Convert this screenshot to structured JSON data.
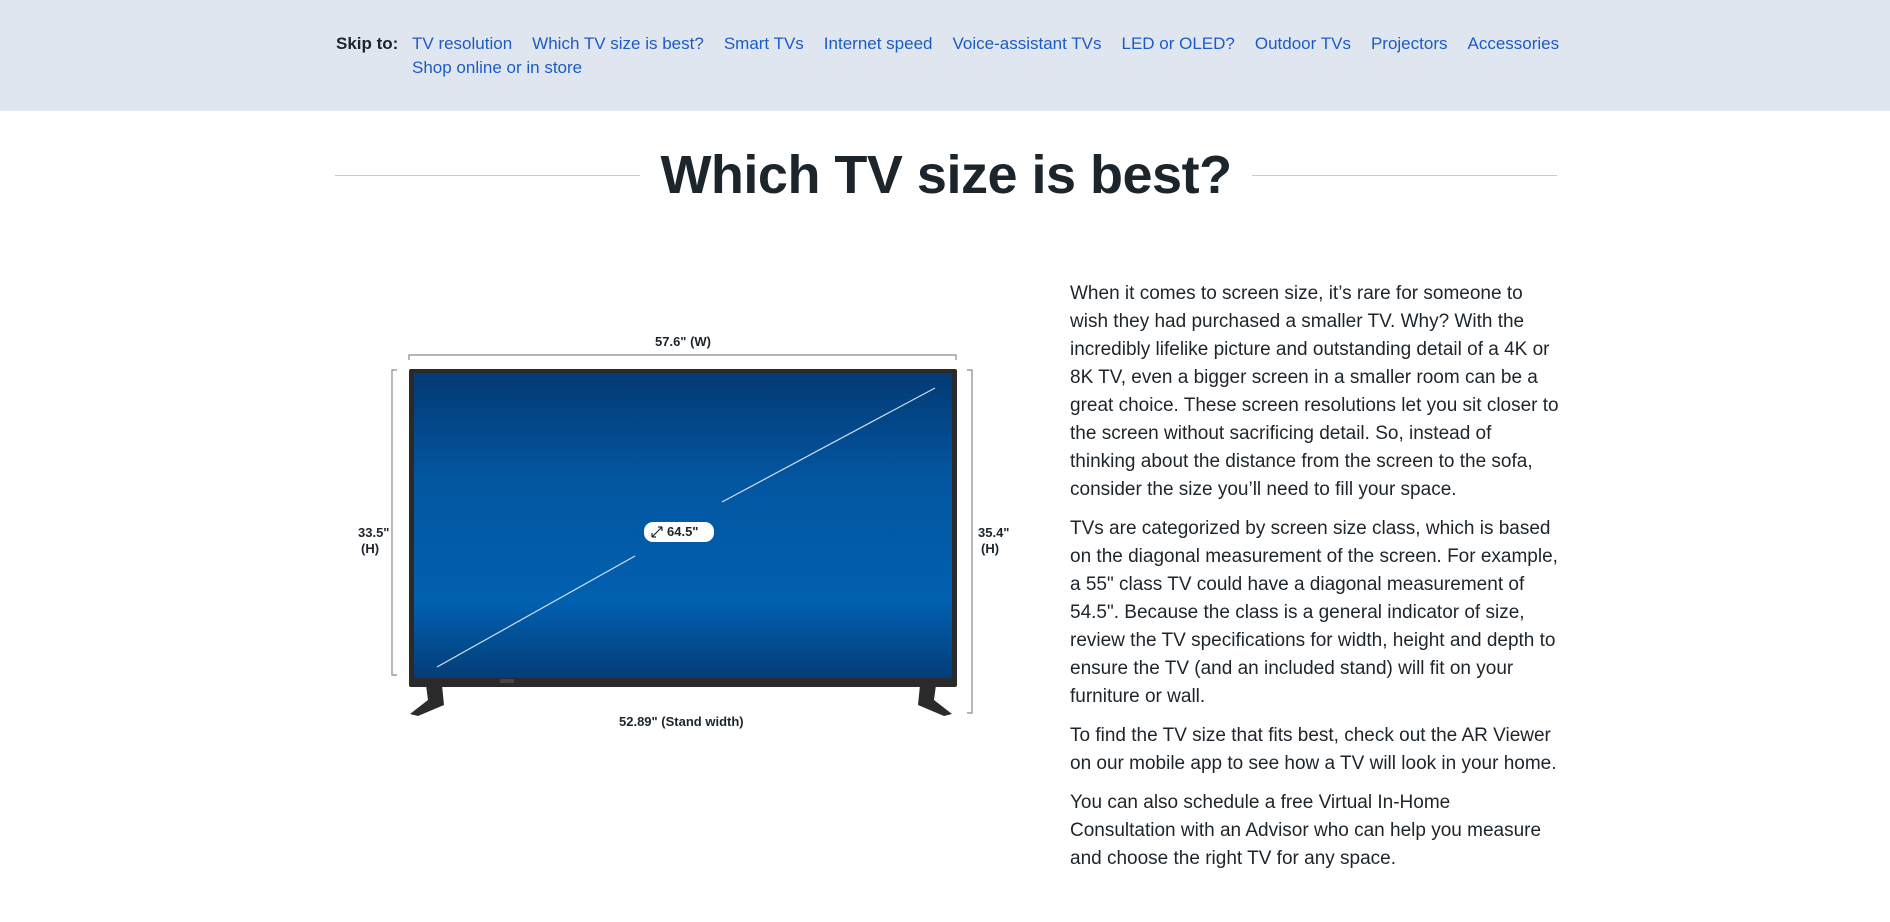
{
  "skip_nav": {
    "label": "Skip to:",
    "links": [
      "TV resolution",
      "Which TV size is best?",
      "Smart TVs",
      "Internet speed",
      "Voice-assistant TVs",
      "LED or OLED?",
      "Outdoor TVs",
      "Projectors",
      "Accessories",
      "Shop online or in store"
    ]
  },
  "section": {
    "title": "Which TV size is best?"
  },
  "tv_diagram": {
    "width_label": "57.6\" (W)",
    "left_height_value": "33.5\"",
    "left_height_unit": "(H)",
    "right_height_value": "35.4\"",
    "right_height_unit": "(H)",
    "diagonal_label": "64.5\"",
    "stand_label": "52.89\" (Stand width)",
    "diagonal_icon": "resize-diagonal-icon",
    "screen_color_top": "#033a74",
    "screen_color_mid": "#0260b0"
  },
  "article": {
    "paragraphs": [
      "When it comes to screen size, it’s rare for someone to wish they had purchased a smaller TV. Why? With the incredibly lifelike picture and outstanding detail of a 4K or 8K TV, even a bigger screen in a smaller room can be a great choice. These screen resolutions let you sit closer to the screen without sacrificing detail. So, instead of thinking about the distance from the screen to the sofa, consider the size you’ll need to fill your space.",
      "TVs are categorized by screen size class, which is based on the diagonal measurement of the screen. For example, a 55\" class TV could have a diagonal measurement of 54.5\". Because the class is a general indicator of size, review the TV specifications for width, height and depth to ensure the TV (and an included stand) will fit on your furniture or wall.",
      "To find the TV size that fits best, check out the AR Viewer on our mobile app to see how a TV will look in your home.",
      "You can also schedule a free Virtual In-Home Consultation with an Advisor who can help you measure and choose the right TV for any space."
    ]
  }
}
